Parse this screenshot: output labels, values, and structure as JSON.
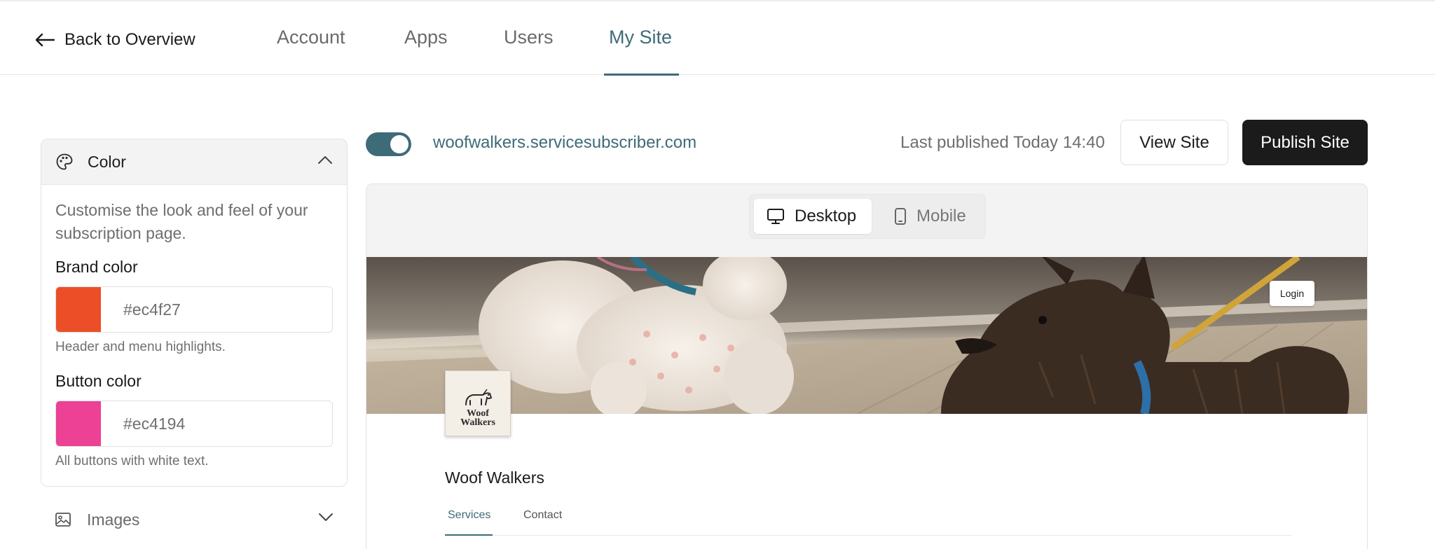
{
  "nav": {
    "back_label": "Back to Overview",
    "tabs": [
      {
        "label": "Account"
      },
      {
        "label": "Apps"
      },
      {
        "label": "Users"
      },
      {
        "label": "My Site"
      }
    ],
    "active_tab": "My Site"
  },
  "sidebar": {
    "color_section": {
      "title": "Color",
      "icon": "palette-icon",
      "description": "Customise the look and feel of your subscription page.",
      "brand": {
        "label": "Brand color",
        "value": "#ec4f27",
        "hint": "Header and menu highlights."
      },
      "button": {
        "label": "Button color",
        "value": "#ec4194",
        "hint": "All buttons with white text."
      }
    },
    "images_section": {
      "title": "Images",
      "icon": "image-icon"
    }
  },
  "toolbar": {
    "published_toggle": true,
    "site_url": "woofwalkers.servicesubscriber.com",
    "last_published": "Last published Today 14:40",
    "view_label": "View Site",
    "publish_label": "Publish Site"
  },
  "preview": {
    "device_toggle": {
      "desktop_label": "Desktop",
      "mobile_label": "Mobile",
      "selected": "Desktop"
    },
    "site": {
      "login_label": "Login",
      "logo_text_line1": "Woof",
      "logo_text_line2": "Walkers",
      "business_name": "Woof Walkers",
      "tabs": [
        {
          "label": "Services"
        },
        {
          "label": "Contact"
        }
      ],
      "active_tab": "Services"
    }
  },
  "colors": {
    "accent": "#3e6b78",
    "brand": "#ec4f27",
    "button": "#ec4194",
    "publish_bg": "#1b1b1b"
  }
}
